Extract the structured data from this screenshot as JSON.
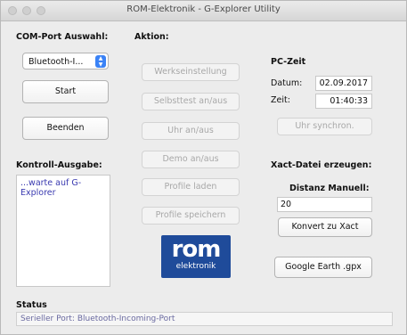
{
  "window": {
    "title": "ROM-Elektronik - G-Explorer Utility"
  },
  "com": {
    "heading": "COM-Port Auswahl:",
    "selected_port": "Bluetooth-I...",
    "start_label": "Start",
    "exit_label": "Beenden"
  },
  "kontroll": {
    "heading": "Kontroll-Ausgabe:",
    "log_lines": [
      "...warte auf G-",
      "Explorer"
    ]
  },
  "aktion": {
    "heading": "Aktion:",
    "buttons": [
      "Werkseinstellung",
      "Selbsttest an/aus",
      "Uhr an/aus",
      "Demo an/aus",
      "Profile laden",
      "Profile speichern"
    ]
  },
  "logo": {
    "top": "rom",
    "bottom": "elektronik"
  },
  "pc_zeit": {
    "heading": "PC-Zeit",
    "datum_label": "Datum:",
    "datum_value": "02.09.2017",
    "zeit_label": "Zeit:",
    "zeit_value": "01:40:33",
    "sync_label": "Uhr synchron."
  },
  "xact": {
    "heading": "Xact-Datei erzeugen:",
    "distanz_label": "Distanz Manuell:",
    "distanz_value": "20",
    "convert_label": "Konvert zu Xact",
    "gpx_label": "Google Earth .gpx"
  },
  "status": {
    "heading": "Status",
    "text": "Serieller Port: Bluetooth-Incoming-Port"
  }
}
